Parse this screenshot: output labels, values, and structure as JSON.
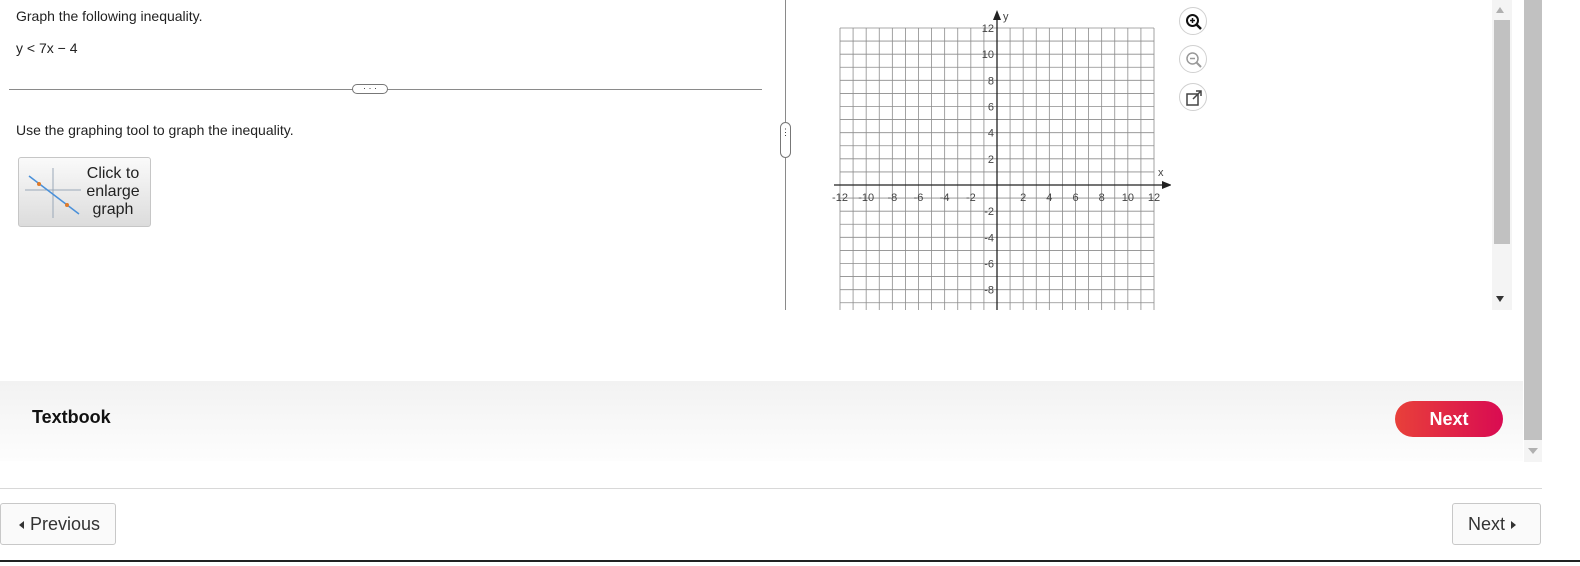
{
  "question": {
    "prompt": "Graph the following inequality.",
    "inequality": "y < 7x − 4",
    "divider_handle": "· · ·",
    "instruction": "Use the graphing tool to graph the inequality.",
    "enlarge_button_label": [
      "Click to",
      "enlarge",
      "graph"
    ]
  },
  "graph": {
    "x_axis_label": "x",
    "y_axis_label": "y",
    "x_range": [
      -12,
      12
    ],
    "y_range": [
      -9,
      12
    ],
    "x_tick_labels": [
      "-12",
      "-10",
      "-8",
      "-6",
      "-4",
      "-2",
      "2",
      "4",
      "6",
      "8",
      "10",
      "12"
    ],
    "y_tick_labels": [
      "12",
      "10",
      "8",
      "6",
      "4",
      "2",
      "-2",
      "-4",
      "-6",
      "-8"
    ],
    "grid": true
  },
  "tools": {
    "zoom_in": "zoom-in-icon",
    "zoom_out": "zoom-out-icon",
    "popout": "external-link-icon"
  },
  "footer": {
    "textbook_label": "Textbook",
    "next_label": "Next",
    "accent_color": "#e0213f"
  },
  "navigation": {
    "previous_label": "Previous",
    "next_label": "Next"
  }
}
